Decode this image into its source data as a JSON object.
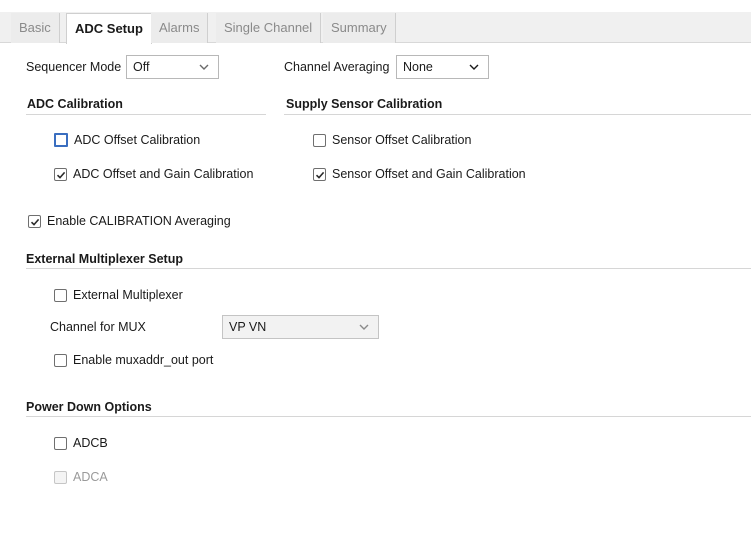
{
  "tabs": [
    {
      "label": "Basic",
      "active": false
    },
    {
      "label": "ADC Setup",
      "active": true
    },
    {
      "label": "Alarms",
      "active": false
    },
    {
      "label": "Single Channel",
      "active": false
    },
    {
      "label": "Summary",
      "active": false
    }
  ],
  "sequencer": {
    "label": "Sequencer Mode",
    "value": "Off"
  },
  "channel_averaging": {
    "label": "Channel Averaging",
    "value": "None"
  },
  "adc_calibration": {
    "title": "ADC Calibration",
    "offset": {
      "label": "ADC Offset Calibration",
      "checked": false
    },
    "offset_gain": {
      "label": "ADC Offset and Gain Calibration",
      "checked": true
    }
  },
  "supply_sensor_calibration": {
    "title": "Supply Sensor Calibration",
    "offset": {
      "label": "Sensor Offset Calibration",
      "checked": false
    },
    "offset_gain": {
      "label": "Sensor Offset and Gain Calibration",
      "checked": true
    }
  },
  "enable_cal_avg": {
    "label": "Enable CALIBRATION Averaging",
    "checked": true
  },
  "ext_mux": {
    "title": "External Multiplexer Setup",
    "external_multiplexer": {
      "label": "External Multiplexer",
      "checked": false
    },
    "channel_for_mux": {
      "label": "Channel for MUX",
      "value": "VP VN"
    },
    "muxaddr": {
      "label": "Enable muxaddr_out port",
      "checked": false
    }
  },
  "power_down": {
    "title": "Power Down Options",
    "adcb": {
      "label": "ADCB",
      "checked": false
    },
    "adca": {
      "label": "ADCA",
      "checked": false,
      "disabled": true
    }
  },
  "colors": {
    "focus_border": "#3a6ec0",
    "tab_bar": "#f0f0f0",
    "rule": "#d6d6d6"
  },
  "icons": {
    "dropdown": "chevron-down-icon",
    "check": "checkmark-icon"
  }
}
